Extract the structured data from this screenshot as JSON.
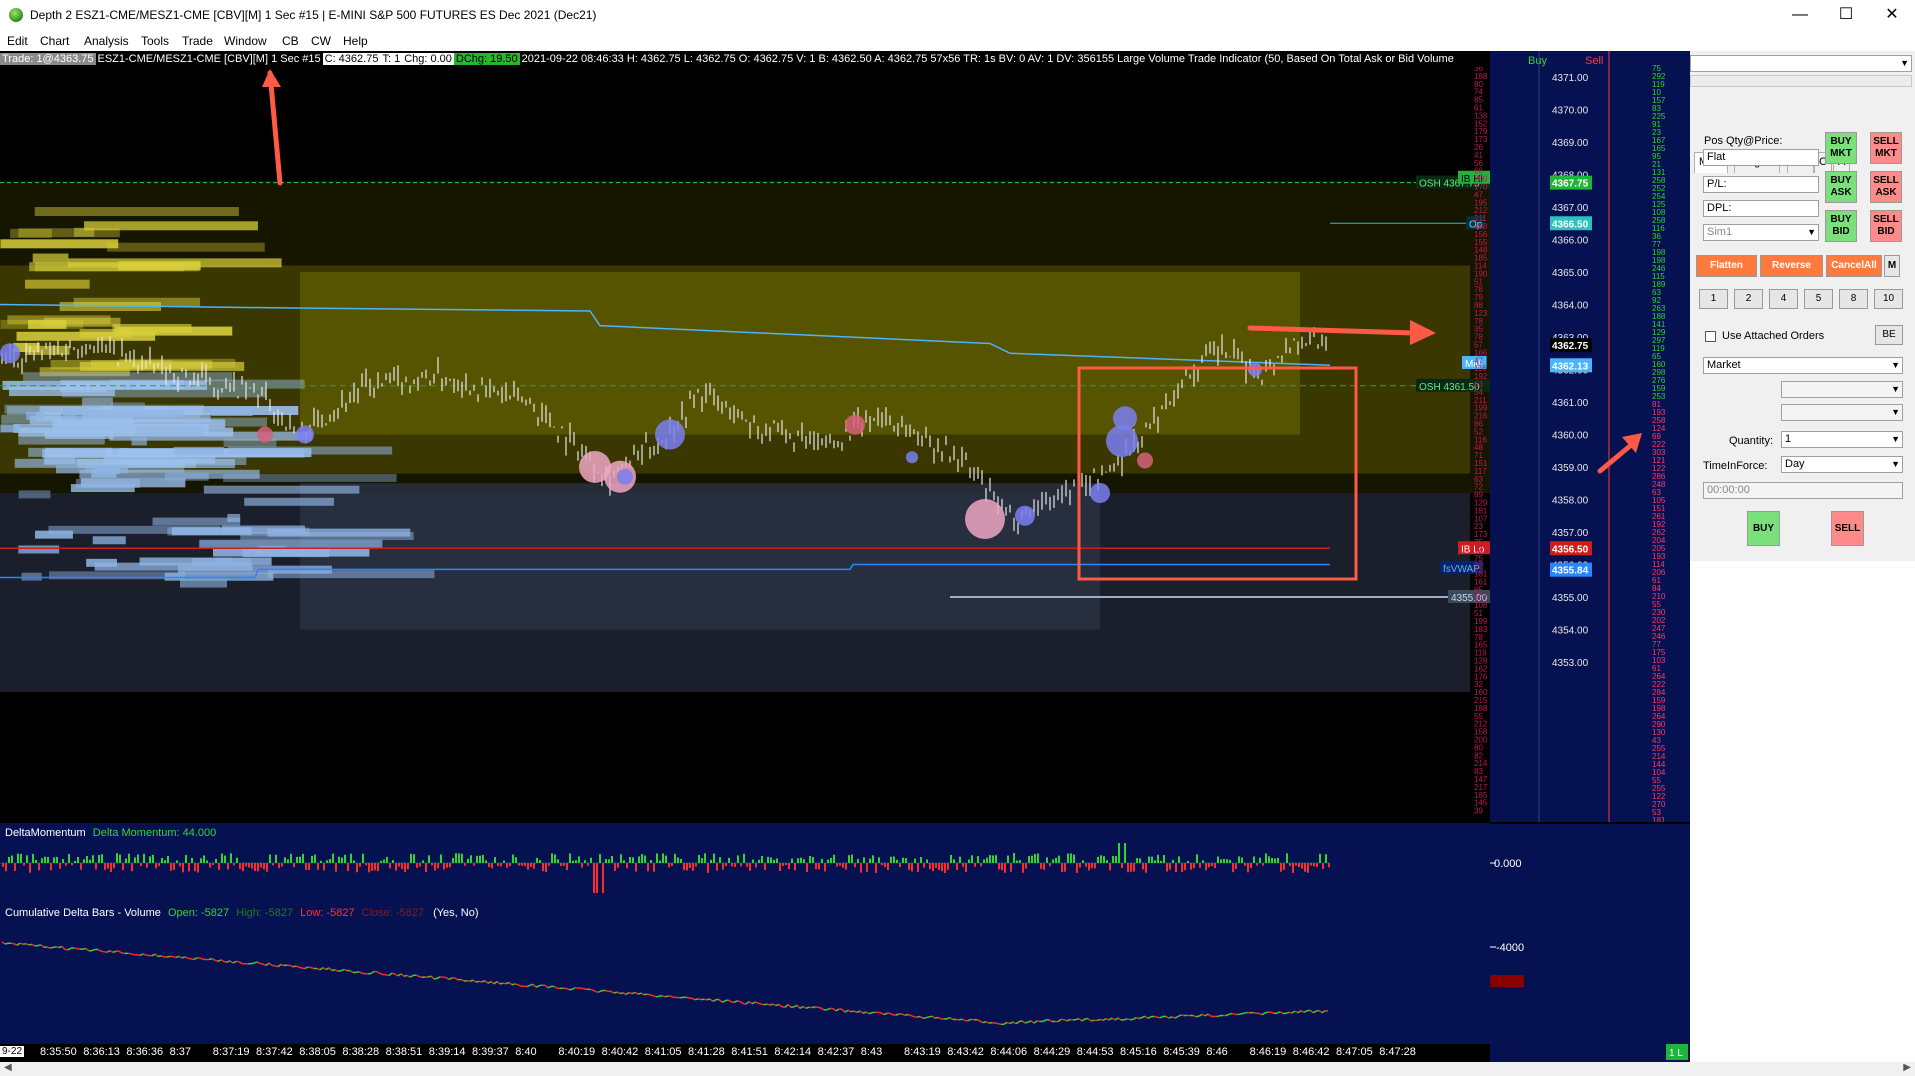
{
  "window": {
    "title": "Depth 2 ESZ1-CME/MESZ1-CME [CBV][M]  1 Sec  #15 | E-MINI S&P 500 FUTURES ES Dec 2021 (Dec21)",
    "minimize": "—",
    "maximize": "☐",
    "close": "✕"
  },
  "menu": [
    "Edit",
    "Chart",
    "Analysis",
    "Tools",
    "Trade",
    "Window",
    "CB",
    "CW",
    "Help"
  ],
  "infobar": {
    "trade": "Trade: 1@4363.75",
    "symbol": "ESZ1-CME/MESZ1-CME [CBV][M]  1 Sec  #15",
    "last": "C: 4362.75",
    "t1": "T: 1",
    "chg": "Chg: 0.00",
    "dchg": "DChg: 19.50",
    "rest": "2021-09-22 08:46:33 H: 4362.75 L: 4362.75 O: 4362.75 V: 1 B: 4362.50 A: 4362.75 57x56 TR: 1s BV: 0 AV: 1 DV: 356155 Large Volume Trade Indicator  (50, Based On Total Ask or Bid Volume"
  },
  "price_axis": {
    "labels": [
      "4371.00",
      "4370.00",
      "4369.00",
      "4368.00",
      "4367.00",
      "4366.00",
      "4365.00",
      "4364.00",
      "4363.00",
      "4362.00",
      "4361.00",
      "4360.00",
      "4359.00",
      "4358.00",
      "4357.00",
      "4356.00",
      "4355.00",
      "4354.00",
      "4353.00"
    ],
    "current_price": "4362.75",
    "mid_price": "4362.13",
    "osh_price": "4367.75",
    "op_price": "4366.50",
    "ib_low_price": "4356.50",
    "vwap_price": "4355.84"
  },
  "line_labels": {
    "osh_top": "OSH 4367.75",
    "osh_mid": "OSH 4361.50",
    "op": "Op",
    "mid": "Mid",
    "ib_lo": "IB Lo",
    "vwap": "fsVWAP",
    "ib_hi": "IB Hi",
    "level": "4355.00"
  },
  "ladder": {
    "buy_label": "Buy",
    "sell_label": "Sell"
  },
  "panel": {
    "tabs": [
      "Main",
      "Targets",
      "Set",
      "C",
      "A"
    ],
    "pos_label": "Pos Qty@Price:",
    "pos_value": "Flat",
    "pl_label": "P/L:",
    "dpl_label": "DPL:",
    "account_value": "Sim1",
    "buy_mkt": "BUY MKT",
    "sell_mkt": "SELL MKT",
    "buy_ask": "BUY ASK",
    "sell_ask": "SELL ASK",
    "buy_bid": "BUY BID",
    "sell_bid": "SELL BID",
    "flatten": "Flatten",
    "reverse": "Reverse",
    "cancel_all": "CancelAll",
    "m": "M",
    "qty_buttons": [
      "1",
      "2",
      "4",
      "5",
      "8",
      "10"
    ],
    "use_attached": "Use Attached Orders",
    "be": "BE",
    "order_type": "Market",
    "quantity_label": "Quantity:",
    "quantity_value": "1",
    "tif_label": "TimeInForce:",
    "tif_value": "Day",
    "time_value": "00:00:00",
    "buy": "BUY",
    "sell": "SELL"
  },
  "delta": {
    "name": "DeltaMomentum",
    "value_label": "Delta Momentum: 44.000",
    "axis_label": "0.000"
  },
  "cumulative": {
    "name": "Cumulative Delta Bars - Volume",
    "open": "Open: -5827",
    "high": "High: -5827",
    "low": "Low: -5827",
    "close": "Close: -5827",
    "flags": "(Yes, No)",
    "axis_label": "-4000"
  },
  "time_axis": {
    "first": "9-22",
    "labels": [
      "8:35:50",
      "8:36:13",
      "8:36:36",
      "8:37",
      "8:37:19",
      "8:37:42",
      "8:38:05",
      "8:38:28",
      "8:38:51",
      "8:39:14",
      "8:39:37",
      "8:40",
      "8:40:19",
      "8:40:42",
      "8:41:05",
      "8:41:28",
      "8:41:51",
      "8:42:14",
      "8:42:37",
      "8:43",
      "8:43:19",
      "8:43:42",
      "8:44:06",
      "8:44:29",
      "8:44:53",
      "8:45:16",
      "8:45:39",
      "8:46",
      "8:46:19",
      "8:46:42",
      "8:47:05",
      "8:47:28"
    ],
    "badge": "1 L"
  },
  "colors": {
    "bg_chart": "#000000",
    "bg_ladder": "#061152",
    "bid_depth": "#8fb4e3",
    "ask_depth": "#6d6b00",
    "annotation": "#ff5a45",
    "vwap": "#2a86ff",
    "ib_low": "#d11c1c"
  }
}
